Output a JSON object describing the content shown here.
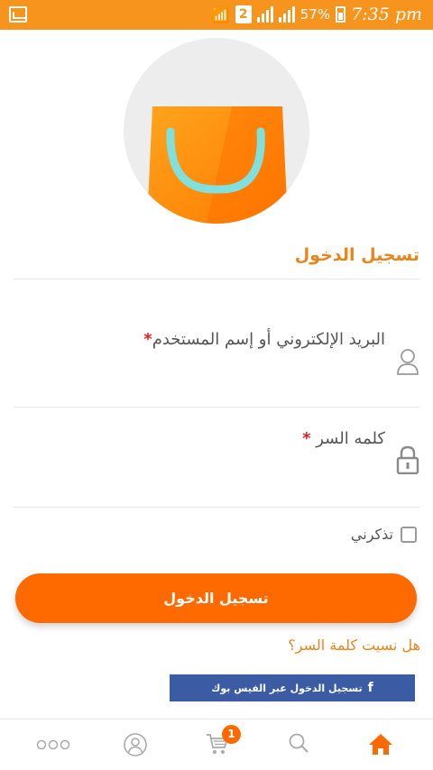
{
  "status_bar": {
    "sim": "2",
    "battery": "57%",
    "time": "7:35 pm"
  },
  "login": {
    "title": "تسجيل الدخول",
    "username_label": "البريد الإلكتروني أو إسم المستخدم",
    "password_label": "كلمه السر",
    "required_mark": "*",
    "remember_label": "تذكرني",
    "submit_label": "تسجيل الدخول",
    "forgot_link": "هل نسيت كلمة السر؟",
    "facebook_label": "تسجيل الدخول عبر الفيس بوك"
  },
  "bottom_nav": {
    "cart_count": "1",
    "items": [
      "more-icon",
      "account-icon",
      "cart-icon",
      "search-icon",
      "home-icon"
    ],
    "active": "home-icon"
  },
  "colors": {
    "accent": "#f7941d",
    "button": "#ff6a00",
    "facebook": "#3b5ba5",
    "required": "#e0201b"
  }
}
